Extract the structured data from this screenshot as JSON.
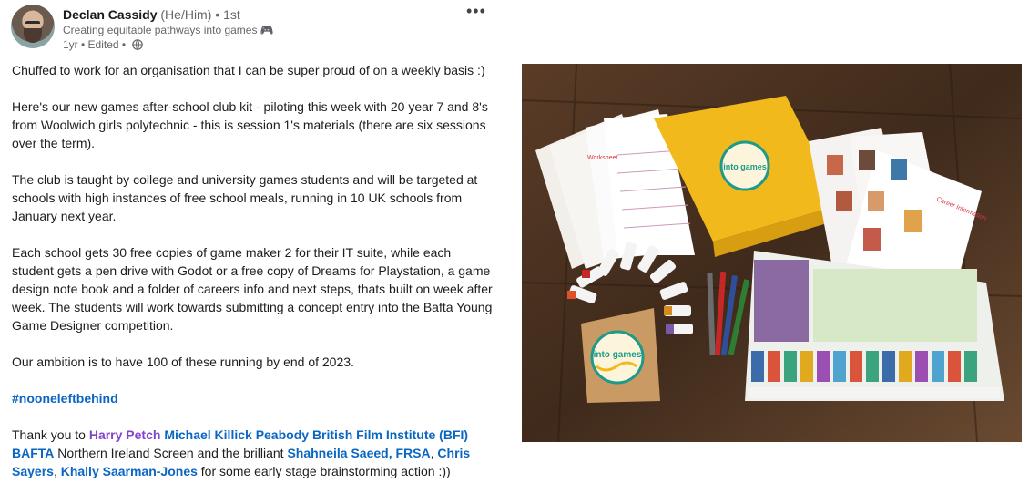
{
  "author": {
    "name": "Declan Cassidy",
    "pronouns": "(He/Him)",
    "degree": "• 1st",
    "headline": "Creating equitable pathways into games 🎮",
    "meta": "1yr • Edited •"
  },
  "more_label": "•••",
  "post": {
    "p1": "Chuffed to work for an organisation that I can be super proud of on a weekly basis :)",
    "p2": "Here's our new games after-school club kit - piloting this week with 20 year 7 and 8's from Woolwich girls polytechnic - this is session 1's materials (there are six sessions over the term).",
    "p3": "The club is taught by college and university games students and will be targeted at schools with high instances of free school meals, running in 10 UK schools from January next year.",
    "p4": "Each school gets 30 free copies of game maker 2 for their IT suite, while each student gets a pen drive with Godot or a free copy of Dreams for Playstation, a game design note book and a folder of careers info and next steps, thats built on week after week. The students will work towards submitting a concept entry into the Bafta Young Game Designer competition.",
    "p5": "Our ambition is to have 100 of these running by end of 2023.",
    "hashtag": "#nooneleftbehind",
    "thanks": {
      "prefix": "Thank you to",
      "mention1": "Harry Petch",
      "mention2": "Michael Killick",
      "mention3": "Peabody",
      "mention4": "British Film Institute (BFI)",
      "mention5": "BAFTA",
      "middle": "Northern Ireland Screen and the brilliant",
      "mention6": "Shahneila Saeed, FRSA",
      "mention7": "Chris Sayers",
      "mention8": "Khally Saarman-Jones",
      "suffix": "for some early stage brainstorming action :))"
    }
  },
  "photo": {
    "folder_logo": "into games",
    "notebook_logo": "into games"
  }
}
